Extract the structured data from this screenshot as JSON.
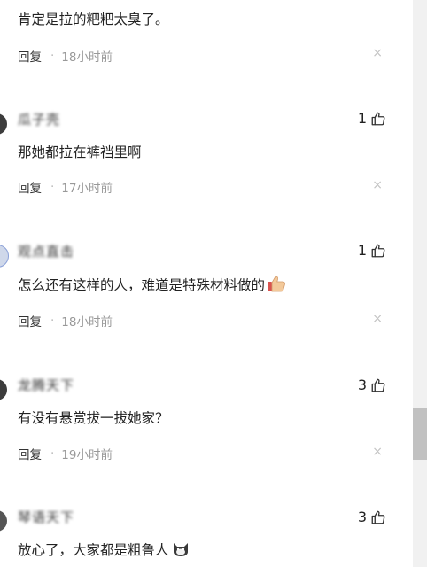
{
  "comments": [
    {
      "name": "",
      "text": "肯定是拉的粑粑太臭了。",
      "reply": "回复",
      "time": "18小时前",
      "likes": ""
    },
    {
      "name": "瓜子壳",
      "text": "那她都拉在裤裆里啊",
      "reply": "回复",
      "time": "17小时前",
      "likes": "1"
    },
    {
      "name": "观点直击",
      "text": "怎么还有这样的人，难道是特殊材料做的",
      "reply": "回复",
      "time": "18小时前",
      "likes": "1"
    },
    {
      "name": "龙腾天下",
      "text": "有没有悬赏拔一拔她家？",
      "reply": "回复",
      "time": "19小时前",
      "likes": "3"
    },
    {
      "name": "琴语天下",
      "text": "放心了，大家都是粗鲁人",
      "reply": "回复",
      "time": "",
      "likes": "3"
    }
  ],
  "close_glyph": "×",
  "dot_glyph": "·",
  "icons": [
    "thumbs-up-icon",
    "close-icon",
    "thumbs-up-emoji",
    "cat-emoji"
  ]
}
